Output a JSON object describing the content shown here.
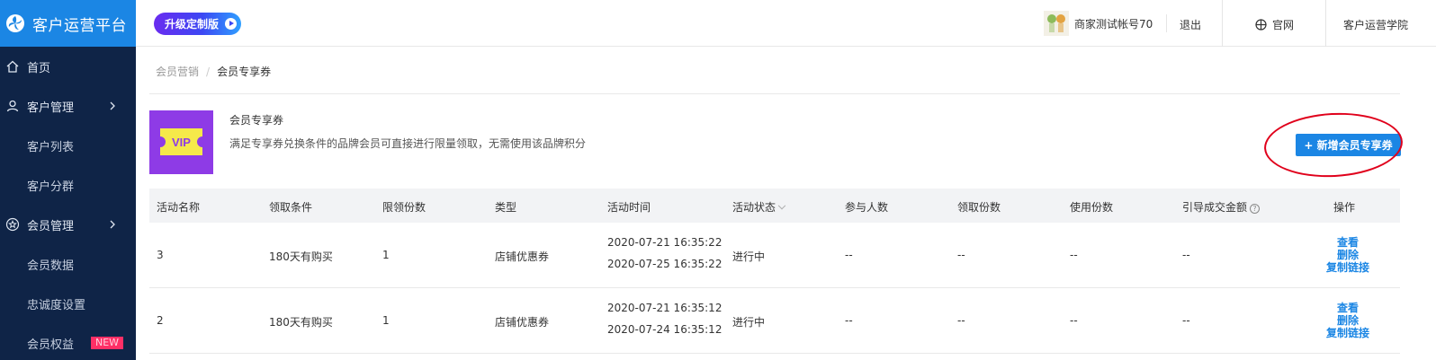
{
  "sidebar": {
    "brand": "客户运营平台",
    "items": [
      {
        "label": "首页"
      },
      {
        "label": "客户管理"
      },
      {
        "label": "客户列表"
      },
      {
        "label": "客户分群"
      },
      {
        "label": "会员管理"
      },
      {
        "label": "会员数据"
      },
      {
        "label": "忠诚度设置"
      },
      {
        "label": "会员权益",
        "badge": "NEW"
      }
    ]
  },
  "topbar": {
    "upgrade": "升级定制版",
    "account": "商家测试帐号70",
    "logout": "退出",
    "official": "官网",
    "academy": "客户运营学院"
  },
  "breadcrumb": {
    "parent": "会员营销",
    "sep": "/",
    "current": "会员专享券"
  },
  "header": {
    "icon_text": "VIP",
    "title": "会员专享券",
    "description": "满足专享券兑换条件的品牌会员可直接进行限量领取，无需使用该品牌积分",
    "add_button": "+ 新增会员专享券"
  },
  "table": {
    "columns": [
      "活动名称",
      "领取条件",
      "限领份数",
      "类型",
      "活动时间",
      "活动状态",
      "参与人数",
      "领取份数",
      "使用份数",
      "引导成交金额",
      "操作"
    ],
    "rows": [
      {
        "name": "3",
        "condition": "180天有购买",
        "limit": "1",
        "type": "店铺优惠券",
        "start": "2020-07-21 16:35:22",
        "end": "2020-07-25 16:35:22",
        "status": "进行中",
        "participants": "--",
        "received": "--",
        "used": "--",
        "amount": "--",
        "ops": [
          "查看",
          "删除",
          "复制链接"
        ]
      },
      {
        "name": "2",
        "condition": "180天有购买",
        "limit": "1",
        "type": "店铺优惠券",
        "start": "2020-07-21 16:35:12",
        "end": "2020-07-24 16:35:12",
        "status": "进行中",
        "participants": "--",
        "received": "--",
        "used": "--",
        "amount": "--",
        "ops": [
          "查看",
          "删除",
          "复制链接"
        ]
      }
    ]
  },
  "colors": {
    "sidebar_bg": "#0f2447",
    "brand_bg": "#1b86e4",
    "primary": "#1b86e4",
    "vip_bg": "#8e3be6",
    "vip_ticket": "#f5e94a",
    "annotation_ring": "#e0001b",
    "new_badge": "#ff2f66"
  }
}
